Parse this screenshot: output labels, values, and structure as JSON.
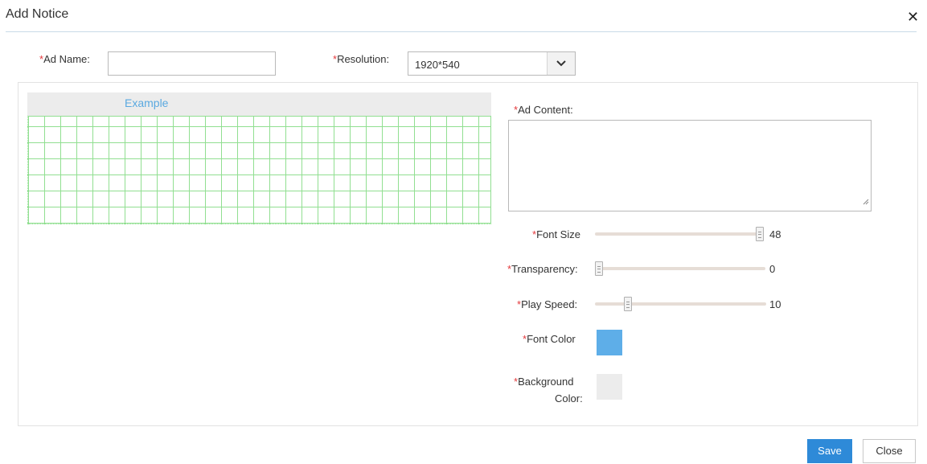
{
  "dialog": {
    "title": "Add Notice"
  },
  "form": {
    "ad_name": {
      "label": "Ad Name:",
      "value": "",
      "placeholder": ""
    },
    "resolution": {
      "label": "Resolution:",
      "selected": "1920*540"
    },
    "ad_content": {
      "label": "Ad Content:",
      "value": ""
    },
    "required_mark": "*"
  },
  "preview": {
    "example_label": "Example"
  },
  "sliders": {
    "font_size": {
      "label": "Font Size",
      "value": "48",
      "fraction": 1.0
    },
    "transparency": {
      "label": "Transparency:",
      "value": "0",
      "fraction": 0.0
    },
    "play_speed": {
      "label": "Play Speed:",
      "value": "10",
      "fraction": 0.2
    }
  },
  "colors": {
    "font_color": {
      "label": "Font Color",
      "hex": "#5eaee8"
    },
    "background_color": {
      "label_line1": "Background",
      "label_line2": "Color:",
      "hex": "#ececec"
    }
  },
  "footer": {
    "save_label": "Save",
    "close_label": "Close"
  }
}
